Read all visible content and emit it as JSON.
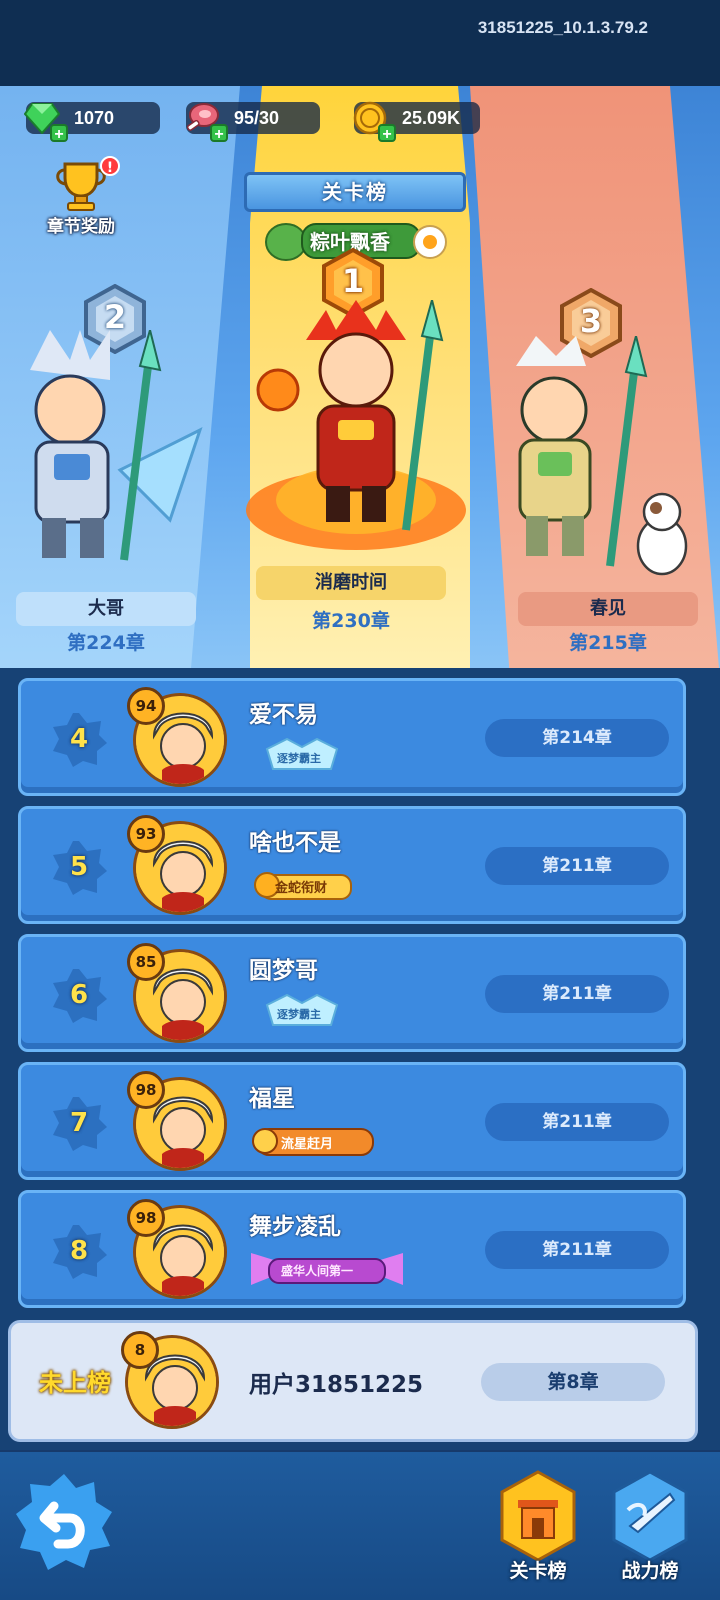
{
  "header": {
    "version": "31851225_10.1.3.79.2"
  },
  "currency": {
    "gems": "1070",
    "stamina": "95/30",
    "gold": "25.09K"
  },
  "reward": {
    "label": "章节奖励",
    "badge": "!"
  },
  "board": {
    "tab_label": "关卡榜",
    "event_banner": "粽叶飘香"
  },
  "podium": [
    {
      "rank": "1",
      "name": "消磨时间",
      "chapter": "第230章"
    },
    {
      "rank": "2",
      "name": "大哥",
      "chapter": "第224章"
    },
    {
      "rank": "3",
      "name": "春见",
      "chapter": "第215章"
    }
  ],
  "list": [
    {
      "rank": "4",
      "level": "94",
      "name": "爱不易",
      "title": "逐梦霸主",
      "chapter": "第214章"
    },
    {
      "rank": "5",
      "level": "93",
      "name": "啥也不是",
      "title": "金蛇衔财",
      "chapter": "第211章"
    },
    {
      "rank": "6",
      "level": "85",
      "name": "圆梦哥",
      "title": "逐梦霸主",
      "chapter": "第211章"
    },
    {
      "rank": "7",
      "level": "98",
      "name": "福星",
      "title": "流星赶月",
      "chapter": "第211章"
    },
    {
      "rank": "8",
      "level": "98",
      "name": "舞步凌乱",
      "title": "盛华人间第一",
      "chapter": "第211章"
    }
  ],
  "mine": {
    "status": "未上榜",
    "level": "8",
    "name": "用户31851225",
    "chapter": "第8章"
  },
  "nav": {
    "stage_board": "关卡榜",
    "power_board": "战力榜"
  },
  "colors": {
    "accent": "#3c8ae0",
    "gold": "#ffd92c",
    "gem": "#35c24a"
  }
}
